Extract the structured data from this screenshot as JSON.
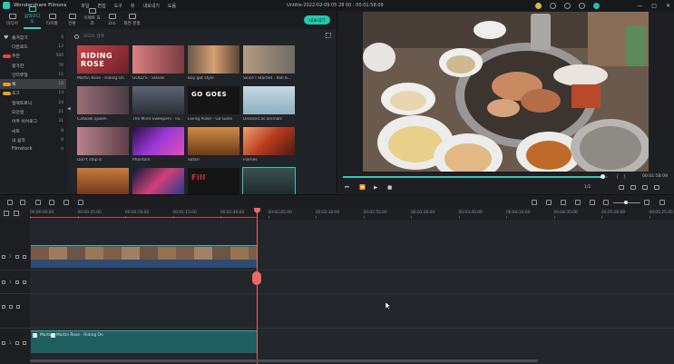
{
  "window": {
    "app_name": "Wondershare Filmora",
    "menu": [
      "파일",
      "편집",
      "도구",
      "뷰",
      "내보내기",
      "도움"
    ],
    "doc_title": "Untitle-2022-02-09 05 28 00 : 00:01:58:09",
    "controls": [
      "—",
      "□",
      "✕"
    ]
  },
  "toolbar": {
    "tabs": [
      {
        "label": "미디어"
      },
      {
        "label": "음악오디오"
      },
      {
        "label": "타이틀"
      },
      {
        "label": "전환"
      },
      {
        "label": "이펙트 효과"
      },
      {
        "label": "요소"
      },
      {
        "label": "화면 분할"
      }
    ],
    "export_label": "내보내기"
  },
  "sidebar": {
    "items": [
      {
        "label": "즐겨찾기",
        "count": "4"
      },
      {
        "label": "다운로드",
        "count": "12"
      },
      {
        "label": "추천",
        "count": "500"
      },
      {
        "label": "평가한",
        "count": "70"
      },
      {
        "label": "인터뷰형",
        "count": "11"
      },
      {
        "label": "록",
        "count": "16"
      },
      {
        "label": "포크",
        "count": "14"
      },
      {
        "label": "일렉트로닉",
        "count": "24"
      },
      {
        "label": "모던앵",
        "count": "21"
      },
      {
        "label": "어쿠 쉬어로그",
        "count": "31"
      },
      {
        "label": "씨트",
        "count": "8"
      },
      {
        "label": "내 음악",
        "count": "0"
      },
      {
        "label": "Filmstock",
        "count": "0"
      }
    ],
    "badge_colors": {
      "red": "#e0473f",
      "orange": "#e79b2f"
    }
  },
  "media": {
    "search_placeholder": "오디오 검색",
    "items": [
      {
        "caption": "Martin Rose - Riding On",
        "thumb_text": "RIDING ROSE",
        "color": "#b33c3c"
      },
      {
        "caption": "GOLD'S - Slaves",
        "thumb_text": "",
        "color": "#c96a6a"
      },
      {
        "caption": "Boy got style",
        "thumb_text": "",
        "color": "#c78a60"
      },
      {
        "caption": "Since I Started - Roll b...",
        "thumb_text": "",
        "color": "#9a8670"
      },
      {
        "caption": "Catwalk queen",
        "thumb_text": "",
        "color": "#8a5a62"
      },
      {
        "caption": "The Mind Sweepers - Fa...",
        "thumb_text": "",
        "color": "#4b4e57"
      },
      {
        "caption": "Living Pulse - Go Goes",
        "thumb_text": "GO GOES",
        "color": "#1a1a1a"
      },
      {
        "caption": "Dressed as animals",
        "thumb_text": "",
        "color": "#a9c4cf"
      },
      {
        "caption": "Don't stop it",
        "thumb_text": "",
        "color": "#7a5b6b"
      },
      {
        "caption": "Phantom",
        "thumb_text": "",
        "color": "#7a2fb3"
      },
      {
        "caption": "Safari",
        "thumb_text": "",
        "color": "#b26a30"
      },
      {
        "caption": "Flames",
        "thumb_text": "",
        "color": "#b84a2c"
      },
      {
        "caption": "",
        "thumb_text": "",
        "color": "#a85a2a"
      },
      {
        "caption": "",
        "thumb_text": "",
        "color": "#12203a"
      },
      {
        "caption": "",
        "thumb_text": "Fill",
        "color": "#1b1b1b"
      },
      {
        "caption": "",
        "thumb_text": "",
        "color": "#2b3d3d"
      }
    ]
  },
  "preview": {
    "progress": 0.98,
    "timecode": "00:01:58:09",
    "quality": "1/2"
  },
  "ruler": {
    "ticks": [
      "00:00:00:00",
      "00:00:25:00",
      "00:00:50:00",
      "00:01:15:00",
      "00:01:40:00",
      "00:02:05:00",
      "00:02:30:00",
      "00:02:55:00",
      "00:03:20:00",
      "00:03:45:00",
      "00:04:10:00",
      "00:04:35:00",
      "00:05:00:00",
      "00:05:25:00"
    ]
  },
  "tracks": {
    "labels": [
      "2",
      "1",
      "",
      "1"
    ],
    "music_clip_label": "Martin Rose - Riding On",
    "music_clip_short": "Martin"
  }
}
